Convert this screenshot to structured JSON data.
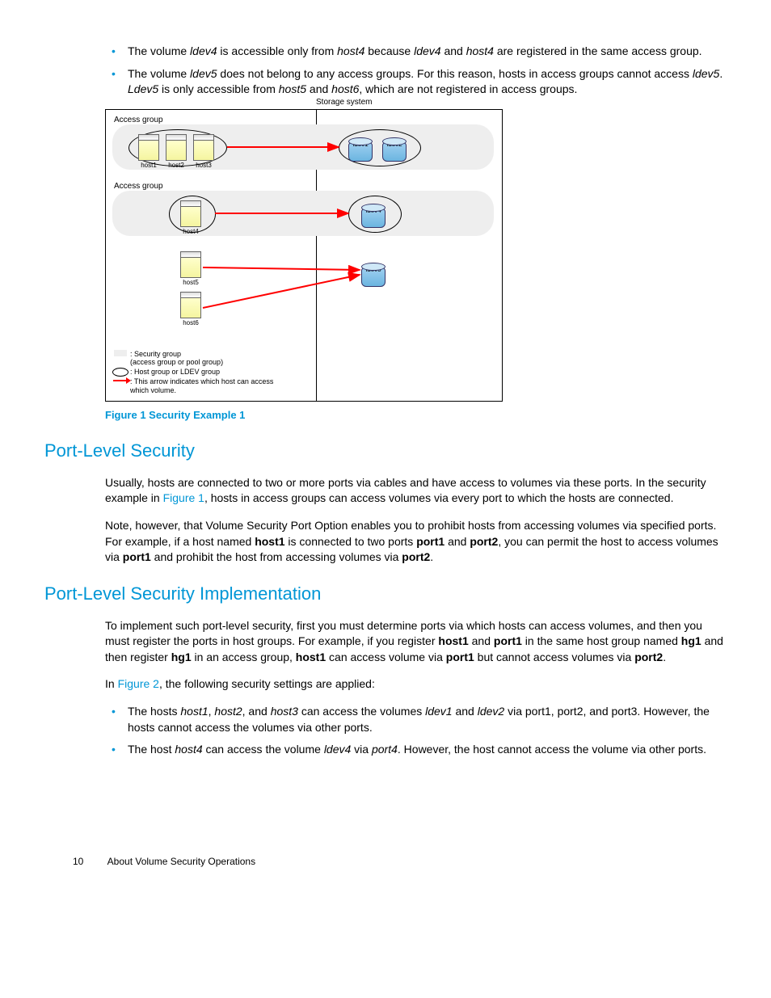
{
  "bullets_top": [
    {
      "pre": "The volume ",
      "i1": "ldev4",
      "mid1": " is accessible only from ",
      "i2": "host4",
      "mid2": " because ",
      "i3": "ldev4",
      "mid3": " and ",
      "i4": "host4",
      "post": " are registered in the same access group."
    },
    {
      "pre": "The volume ",
      "i1": "ldev5",
      "mid1": " does not belong to any access groups. For this reason, hosts in access groups cannot access ",
      "i2": "ldev5",
      "mid2": ". ",
      "i3": "Ldev5",
      "mid3": " is only accessible from ",
      "i4": "host5",
      "mid4": " and ",
      "i5": "host6",
      "post": ", which are not registered in access groups."
    }
  ],
  "diagram": {
    "storage_label": "Storage system",
    "access_group": "Access group",
    "hosts": [
      "host1",
      "host2",
      "host3",
      "host4",
      "host5",
      "host6"
    ],
    "ldevs": [
      "ldev1",
      "ldev2",
      "ldev4",
      "ldev5"
    ],
    "legend": {
      "l1": ": Security group",
      "l1b": "  (access group or pool group)",
      "l2": ": Host group or LDEV group",
      "l3": ": This arrow indicates which host can access",
      "l3b": "  which volume."
    }
  },
  "fig_caption": "Figure 1 Security Example 1",
  "h_port": "Port-Level Security",
  "p_port1a": "Usually, hosts are connected to two or more ports via cables and have access to volumes via these ports. In the security example in ",
  "link_fig1": "Figure 1",
  "p_port1b": ", hosts in access groups can access volumes via every port to which the hosts are connected.",
  "p_port2": {
    "t1": "Note, however, that Volume Security Port Option enables you to prohibit hosts from accessing volumes via specified ports. For example, if a host named ",
    "b1": "host1",
    "t2": " is connected to two ports ",
    "b2": "port1",
    "t3": " and ",
    "b3": "port2",
    "t4": ", you can permit the host to access volumes via ",
    "b4": "port1",
    "t5": " and prohibit the host from accessing volumes via ",
    "b5": "port2",
    "t6": "."
  },
  "h_impl": "Port-Level Security Implementation",
  "p_impl1": {
    "t1": "To implement such port-level security, first you must determine ports via which hosts can access volumes, and then you must register the ports in host groups. For example, if you register ",
    "b1": "host1",
    "t2": " and ",
    "b2": "port1",
    "t3": " in the same host group named ",
    "b3": "hg1",
    "t4": " and then register ",
    "b4": "hg1",
    "t5": " in an access group, ",
    "b5": "host1",
    "t6": " can access volume via ",
    "b6": "port1",
    "t7": " but cannot access volumes via ",
    "b7": "port2",
    "t8": "."
  },
  "p_impl2a": "In ",
  "link_fig2": "Figure 2",
  "p_impl2b": ", the following security settings are applied:",
  "bullets_bottom": [
    {
      "t1": "The hosts ",
      "i1": "host1",
      "t2": ", ",
      "i2": "host2",
      "t3": ", and ",
      "i3": "host3",
      "t4": " can access the volumes ",
      "i4": "ldev1",
      "t5": " and ",
      "i5": "ldev2",
      "t6": " via port1, port2, and port3. However, the hosts cannot access the volumes via other ports."
    },
    {
      "t1": "The host ",
      "i1": "host4",
      "t2": " can access the volume ",
      "i2": "ldev4",
      "t3": " via ",
      "i3": "port4",
      "t4": ". However, the host cannot access the volume via other ports."
    }
  ],
  "footer": {
    "page": "10",
    "title": "About Volume Security Operations"
  }
}
